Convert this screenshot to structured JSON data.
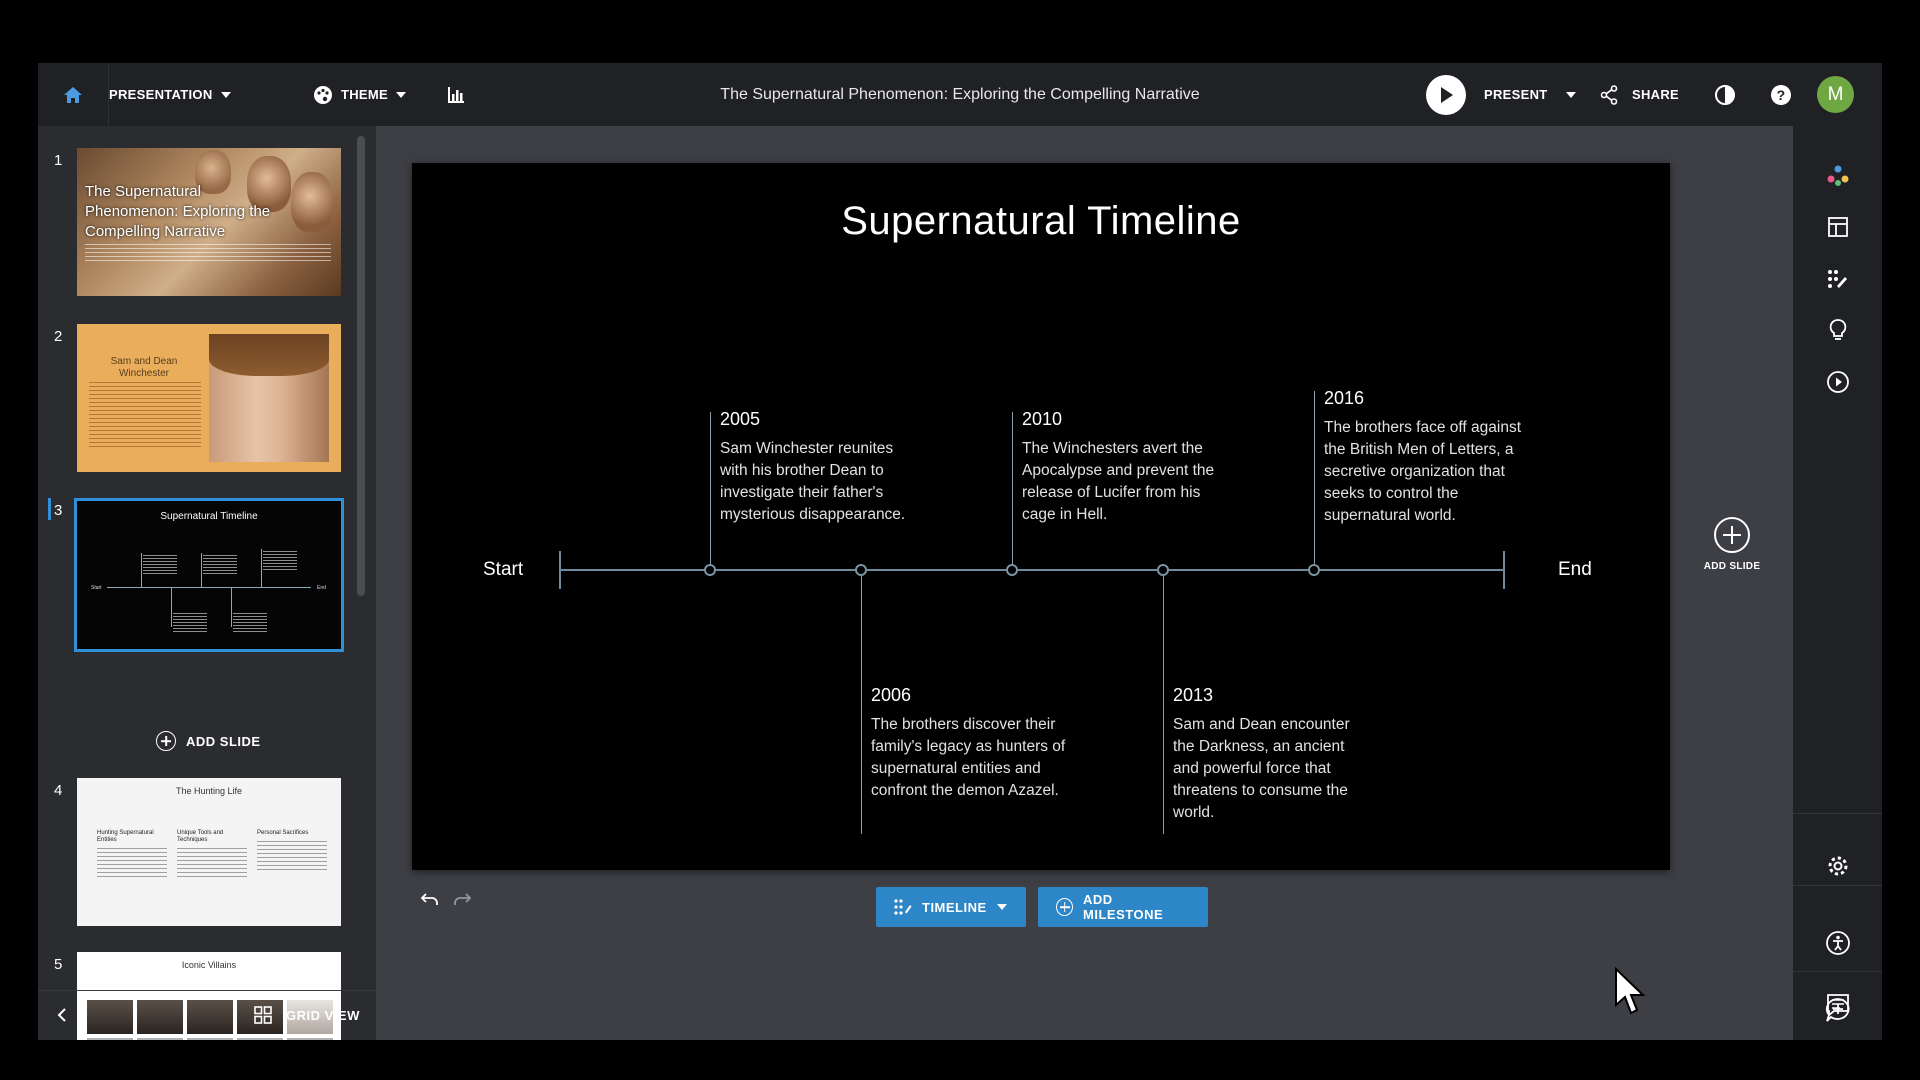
{
  "app": {
    "document_title": "The Supernatural Phenomenon: Exploring the Compelling Narrative",
    "accent_color": "#2d86c8",
    "user_initial": "M"
  },
  "toolbar": {
    "presentation_label": "PRESENTATION",
    "theme_label": "THEME",
    "present_label": "PRESENT",
    "share_label": "SHARE"
  },
  "slides_panel": {
    "slides": [
      {
        "number": "1",
        "title": "The Supernatural Phenomenon: Exploring the Compelling Narrative"
      },
      {
        "number": "2",
        "title": "Sam and Dean Winchester"
      },
      {
        "number": "3",
        "title": "Supernatural Timeline"
      },
      {
        "number": "4",
        "title": "The Hunting Life",
        "columns": [
          "Hunting Supernatural Entities",
          "Unique Tools and Techniques",
          "Personal Sacrifices"
        ]
      },
      {
        "number": "5",
        "title": "Iconic Villains"
      }
    ],
    "selected_slide": "3",
    "add_slide_label": "ADD SLIDE",
    "grid_view_label": "GRID VIEW"
  },
  "slide": {
    "title": "Supernatural Timeline",
    "start_label": "Start",
    "end_label": "End",
    "milestones": [
      {
        "year": "2005",
        "text": "Sam Winchester reunites with his brother Dean to investigate their father's mysterious disappearance."
      },
      {
        "year": "2006",
        "text": "The brothers discover their family's legacy as hunters of supernatural entities and confront the demon Azazel."
      },
      {
        "year": "2010",
        "text": "The Winchesters avert the Apocalypse and prevent the release of Lucifer from his cage in Hell."
      },
      {
        "year": "2013",
        "text": "Sam and Dean encounter the Darkness, an ancient and powerful force that threatens to consume the world."
      },
      {
        "year": "2016",
        "text": "The brothers face off against the British Men of Letters, a secretive organization that seeks to control the supernatural world."
      }
    ]
  },
  "slide_controls": {
    "timeline_label": "TIMELINE",
    "add_milestone_label": "ADD MILESTONE",
    "add_slide_label": "ADD SLIDE"
  },
  "icons": [
    "home-icon",
    "palette-icon",
    "chart-icon",
    "play-icon",
    "share-icon",
    "contrast-icon",
    "help-icon",
    "undo-icon",
    "redo-icon",
    "dots-icon",
    "layout-icon",
    "edit-grid-icon",
    "lightbulb-icon",
    "play-circle-icon",
    "gear-icon",
    "accessibility-icon",
    "comment-add-icon",
    "notes-icon",
    "grid-icon",
    "chevron-left-icon",
    "cursor-icon"
  ]
}
